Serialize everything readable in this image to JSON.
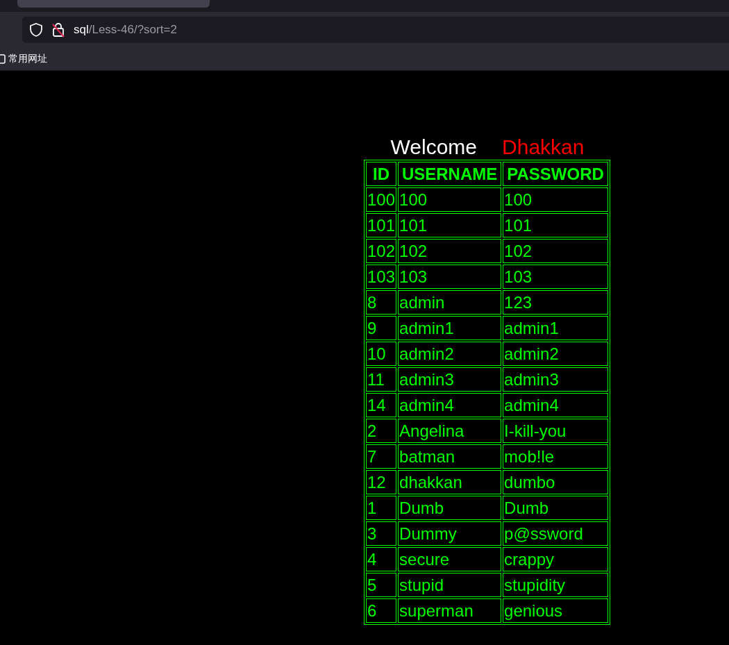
{
  "address_bar": {
    "host": "sql",
    "path": "/Less-46/?sort=2"
  },
  "bookmarks_bar": {
    "items": [
      "常用网址"
    ]
  },
  "welcome": {
    "greeting": "Welcome",
    "name": "Dhakkan"
  },
  "table": {
    "columns": [
      "ID",
      "USERNAME",
      "PASSWORD"
    ],
    "rows": [
      [
        "100",
        "100",
        "100"
      ],
      [
        "101",
        "101",
        "101"
      ],
      [
        "102",
        "102",
        "102"
      ],
      [
        "103",
        "103",
        "103"
      ],
      [
        "8",
        "admin",
        "123"
      ],
      [
        "9",
        "admin1",
        "admin1"
      ],
      [
        "10",
        "admin2",
        "admin2"
      ],
      [
        "11",
        "admin3",
        "admin3"
      ],
      [
        "14",
        "admin4",
        "admin4"
      ],
      [
        "2",
        "Angelina",
        "I-kill-you"
      ],
      [
        "7",
        "batman",
        "mob!le"
      ],
      [
        "12",
        "dhakkan",
        "dumbo"
      ],
      [
        "1",
        "Dumb",
        "Dumb"
      ],
      [
        "3",
        "Dummy",
        "p@ssword"
      ],
      [
        "4",
        "secure",
        "crappy"
      ],
      [
        "5",
        "stupid",
        "stupidity"
      ],
      [
        "6",
        "superman",
        "genious"
      ]
    ]
  }
}
